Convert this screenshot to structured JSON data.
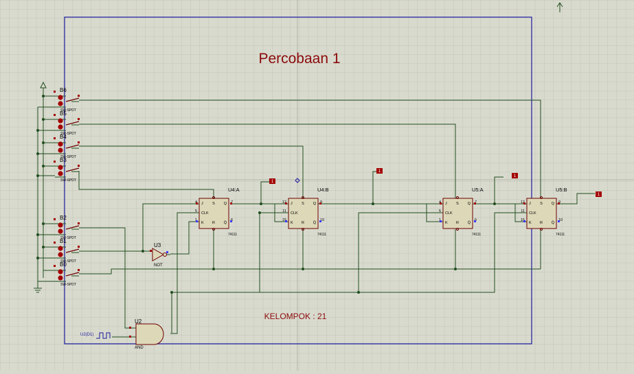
{
  "sheet": {
    "title": "Percobaan 1",
    "footer": "KELOMPOK : 21"
  },
  "switches": [
    {
      "ref": "B6",
      "type": "SW-SPDT"
    },
    {
      "ref": "B5",
      "type": "SW-SPDT"
    },
    {
      "ref": "B4",
      "type": "SW-SPDT"
    },
    {
      "ref": "B3",
      "type": "SW-SPDT"
    },
    {
      "ref": "B2",
      "type": "SW-SPDT"
    },
    {
      "ref": "B1",
      "type": "SW-SPDT"
    },
    {
      "ref": "B0",
      "type": "SW-SPDT"
    }
  ],
  "flipflops": [
    {
      "ref": "U4:A",
      "part": "74111",
      "pin_j": "4",
      "pin_clk": "5",
      "pin_k": "1",
      "pin_q": "7",
      "pin_qb": "6",
      "pin_s": "2",
      "pin_r": "3"
    },
    {
      "ref": "U4:B",
      "part": "74111",
      "pin_j": "12",
      "pin_clk": "11",
      "pin_k": "15",
      "pin_q": "9",
      "pin_qb": "10",
      "pin_s": "14",
      "pin_r": "13"
    },
    {
      "ref": "U5:A",
      "part": "74111",
      "pin_j": "4",
      "pin_clk": "5",
      "pin_k": "1",
      "pin_q": "7",
      "pin_qb": "6",
      "pin_s": "2",
      "pin_r": "3"
    },
    {
      "ref": "U5:B",
      "part": "74111",
      "pin_j": "12",
      "pin_clk": "11",
      "pin_k": "15",
      "pin_q": "9",
      "pin_qb": "10",
      "pin_s": "14",
      "pin_r": "13"
    }
  ],
  "pin_labels": {
    "j": "J",
    "clk": "CLK",
    "k": "K",
    "q": "Q",
    "qb": "Q̄",
    "s": "S",
    "r": "R"
  },
  "gates": {
    "not": {
      "ref": "U3",
      "type": "NOT"
    },
    "and": {
      "ref": "U2",
      "type": "AND"
    }
  },
  "clock": {
    "label": "U2(D1)"
  },
  "colors": {
    "background": "#d9dace",
    "grid": "#c3c4b8",
    "border": "#1a1a9e",
    "wire": "#1f4d1f",
    "component_fill": "#ddd8b8",
    "component_stroke": "#6b0000",
    "title": "#8b0a0a",
    "probe": "#a30000"
  }
}
